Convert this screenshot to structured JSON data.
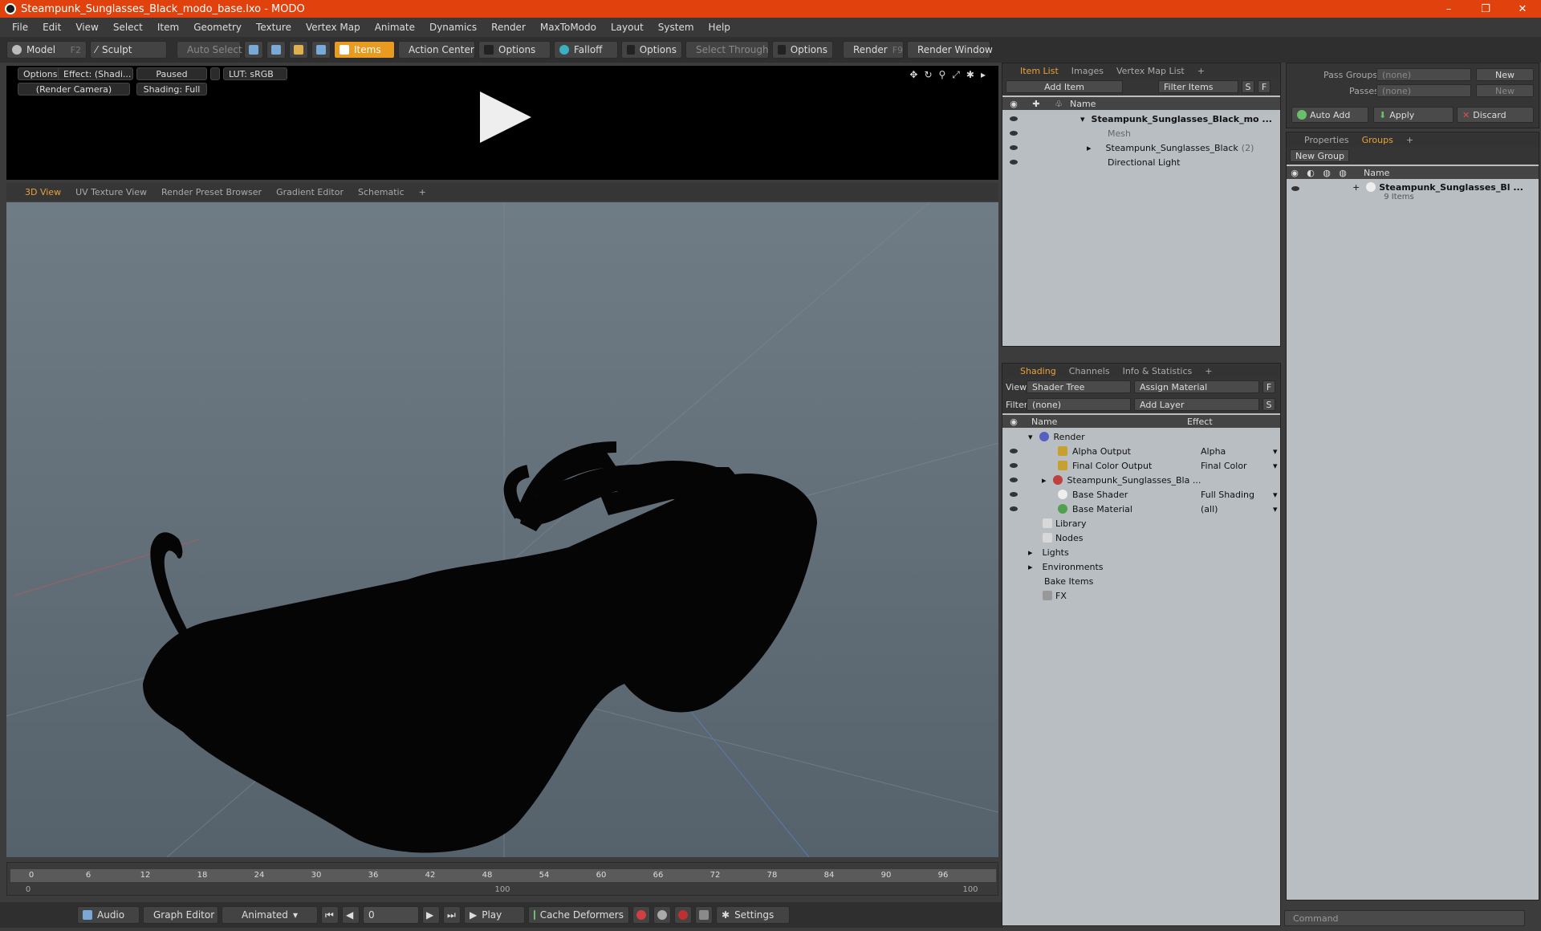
{
  "window": {
    "title": "Steampunk_Sunglasses_Black_modo_base.lxo - MODO",
    "min": "–",
    "max": "❐",
    "close": "✕"
  },
  "menu": [
    "File",
    "Edit",
    "View",
    "Select",
    "Item",
    "Geometry",
    "Texture",
    "Vertex Map",
    "Animate",
    "Dynamics",
    "Render",
    "MaxToModo",
    "Layout",
    "System",
    "Help"
  ],
  "toolbar": {
    "model": "Model",
    "model_key": "F2",
    "sculpt": "Sculpt",
    "auto_select": "Auto Select",
    "items": "Items",
    "action_center": "Action Center",
    "options1": "Options",
    "falloff": "Falloff",
    "options2": "Options",
    "select_through": "Select Through",
    "options3": "Options",
    "render": "Render",
    "render_key": "F9",
    "render_window": "Render Window"
  },
  "preview": {
    "options": "Options",
    "effect": "Effect: (Shadi...",
    "paused": "Paused",
    "lut": "LUT: sRGB",
    "camera": "(Render Camera)",
    "shading": "Shading: Full"
  },
  "viewport_tabs": [
    "3D View",
    "UV Texture View",
    "Render Preset Browser",
    "Gradient Editor",
    "Schematic",
    "+"
  ],
  "timeline": {
    "major": [
      "0",
      "6",
      "12",
      "18",
      "24",
      "30",
      "36",
      "42",
      "48",
      "54",
      "60",
      "66",
      "72",
      "78",
      "84",
      "90",
      "96"
    ],
    "minor": [
      "0",
      "100",
      "100"
    ]
  },
  "bottom": {
    "audio": "Audio",
    "graph_editor": "Graph Editor",
    "animated": "Animated",
    "frame": "0",
    "play": "Play",
    "cache": "Cache Deformers",
    "settings": "Settings"
  },
  "itemlist": {
    "tabs": [
      "Item List",
      "Images",
      "Vertex Map List",
      "+"
    ],
    "add_item": "Add Item",
    "filter": "Filter Items",
    "s": "S",
    "f": "F",
    "col_name": "Name",
    "rows": [
      {
        "label": "Steampunk_Sunglasses_Black_mo ...",
        "extra": ""
      },
      {
        "label": "Mesh",
        "extra": ""
      },
      {
        "label": "Steampunk_Sunglasses_Black",
        "extra": "(2)"
      },
      {
        "label": "Directional Light",
        "extra": ""
      }
    ]
  },
  "shading": {
    "tabs": [
      "Shading",
      "Channels",
      "Info & Statistics",
      "+"
    ],
    "view_label": "View",
    "view_val": "Shader Tree",
    "assign": "Assign Material",
    "f": "F",
    "filter_label": "Filter",
    "filter_val": "(none)",
    "add_layer": "Add Layer",
    "s": "S",
    "col_name": "Name",
    "col_effect": "Effect",
    "rows": [
      {
        "label": "Render",
        "effect": ""
      },
      {
        "label": "Alpha Output",
        "effect": "Alpha"
      },
      {
        "label": "Final Color Output",
        "effect": "Final Color"
      },
      {
        "label": "Steampunk_Sunglasses_Bla ...",
        "effect": ""
      },
      {
        "label": "Base Shader",
        "effect": "Full Shading"
      },
      {
        "label": "Base Material",
        "effect": "(all)"
      },
      {
        "label": "Library",
        "effect": ""
      },
      {
        "label": "Nodes",
        "effect": ""
      },
      {
        "label": "Lights",
        "effect": ""
      },
      {
        "label": "Environments",
        "effect": ""
      },
      {
        "label": "Bake Items",
        "effect": ""
      },
      {
        "label": "FX",
        "effect": ""
      }
    ]
  },
  "passes": {
    "pass_groups": "Pass Groups",
    "pass_val": "(none)",
    "new1": "New",
    "passes": "Passes",
    "passes_val": "(none)",
    "new2": "New",
    "auto_add": "Auto Add",
    "apply": "Apply",
    "discard": "Discard"
  },
  "groups": {
    "tabs": [
      "Properties",
      "Groups",
      "+"
    ],
    "new_group": "New Group",
    "col_name": "Name",
    "group_name": "Steampunk_Sunglasses_Bl ...",
    "group_count": "9 Items"
  },
  "command": {
    "placeholder": "Command"
  }
}
